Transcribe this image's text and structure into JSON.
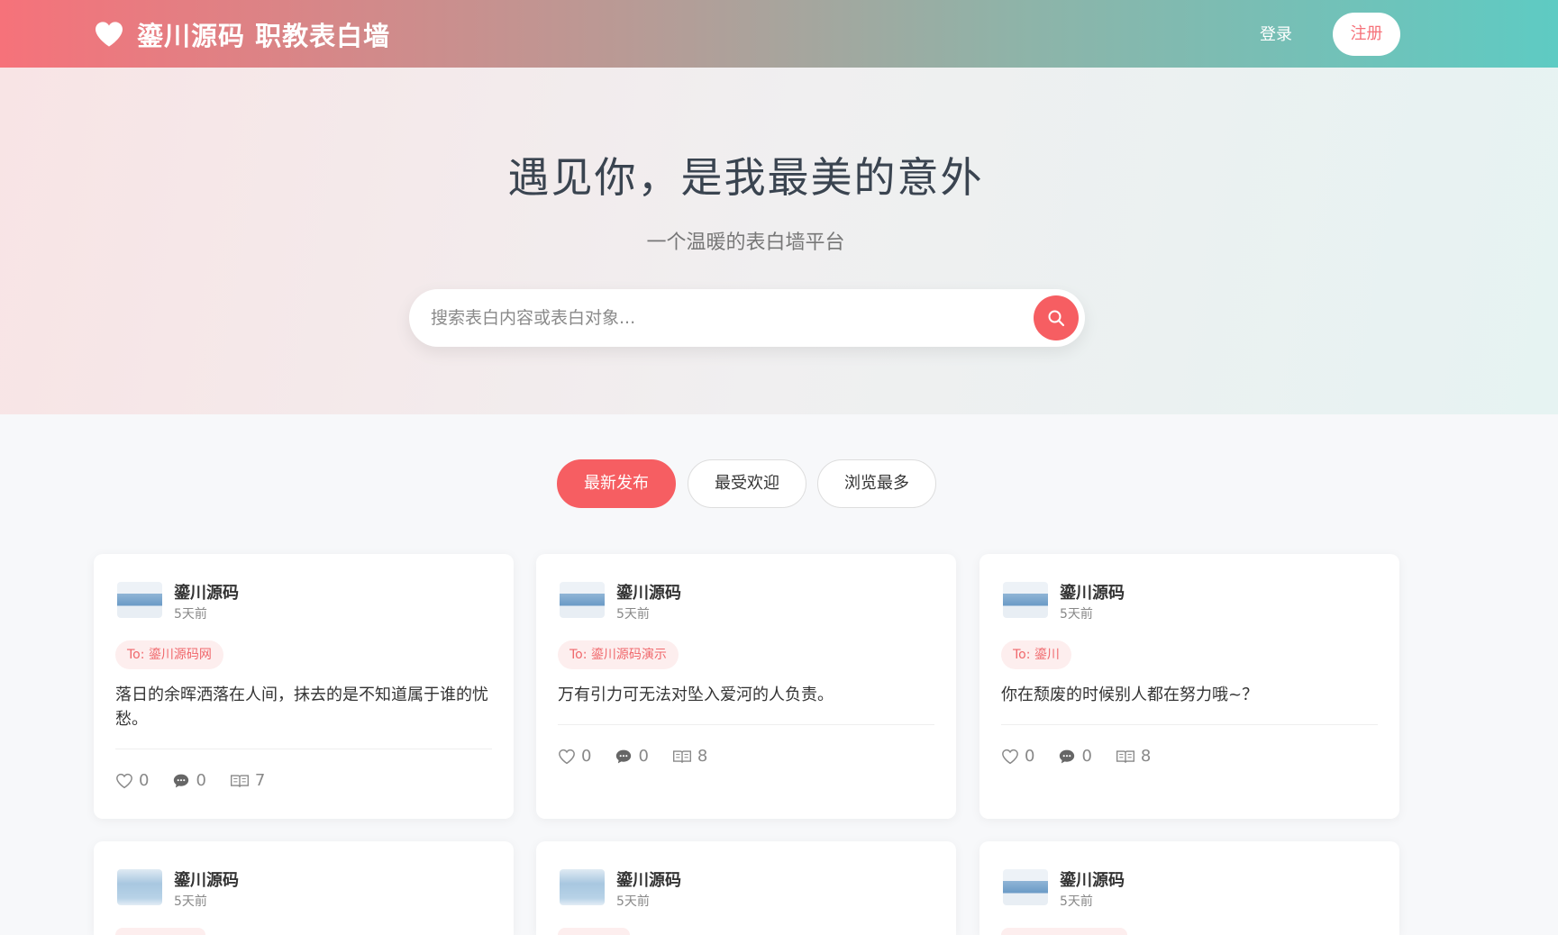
{
  "header": {
    "brand": "鎏川源码 职教表白墙",
    "login": "登录",
    "register": "注册"
  },
  "hero": {
    "title": "遇见你，是我最美的意外",
    "subtitle": "一个温暖的表白墙平台",
    "search_placeholder": "搜索表白内容或表白对象..."
  },
  "tabs": [
    {
      "label": "最新发布",
      "active": true
    },
    {
      "label": "最受欢迎",
      "active": false
    },
    {
      "label": "浏览最多",
      "active": false
    }
  ],
  "cards": [
    {
      "author": "鎏川源码",
      "time": "5天前",
      "to": "To: 鎏川源码网",
      "content": "落日的余晖洒落在人间，抹去的是不知道属于谁的忧愁。",
      "likes": "0",
      "comments": "0",
      "views": "7"
    },
    {
      "author": "鎏川源码",
      "time": "5天前",
      "to": "To: 鎏川源码演示",
      "content": "万有引力可无法对坠入爱河的人负责。",
      "likes": "0",
      "comments": "0",
      "views": "8"
    },
    {
      "author": "鎏川源码",
      "time": "5天前",
      "to": "To: 鎏川",
      "content": "你在颓废的时候别人都在努力哦~？",
      "likes": "0",
      "comments": "0",
      "views": "8"
    },
    {
      "author": "鎏川源码",
      "time": "5天前"
    },
    {
      "author": "鎏川源码",
      "time": "5天前"
    },
    {
      "author": "鎏川源码",
      "time": "5天前"
    }
  ],
  "colors": {
    "accent": "#f65e62",
    "header_start": "#f6727a",
    "header_end": "#5ecbc3"
  }
}
